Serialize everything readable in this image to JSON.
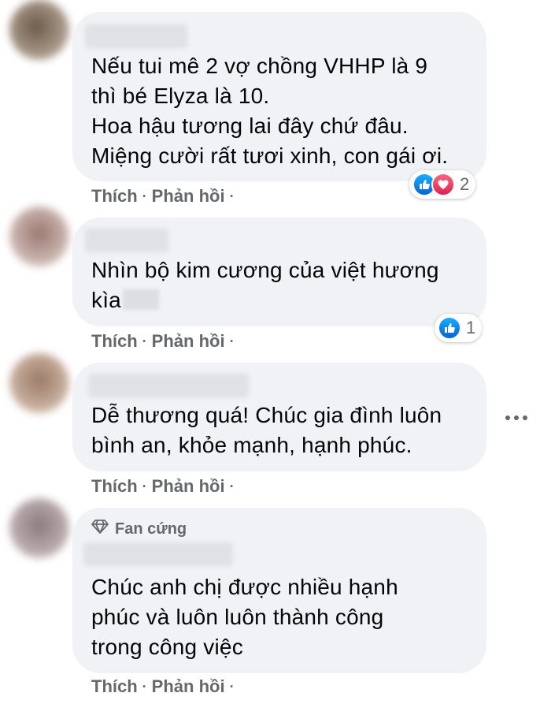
{
  "comments": [
    {
      "text": "Nếu tui mê 2 vợ chồng VHHP là 9\nthì bé Elyza là 10.\nHoa hậu tương lai đây chứ đâu.\nMiệng cười rất tươi xinh, con gái ơi.",
      "like": "Thích",
      "reply": "Phản hồi",
      "reaction_count": "2"
    },
    {
      "text": "Nhìn bộ kim cương của việt hương\nkìa",
      "like": "Thích",
      "reply": "Phản hồi",
      "reaction_count": "1"
    },
    {
      "text": "Dễ thương quá! Chúc gia đình luôn\nbình an, khỏe mạnh, hạnh phúc.",
      "like": "Thích",
      "reply": "Phản hồi"
    },
    {
      "badge": "Fan cứng",
      "text": "Chúc anh chị được nhiều hạnh\nphúc và luôn luôn thành công\ntrong công việc",
      "like": "Thích",
      "reply": "Phản hồi"
    }
  ],
  "separator": "·",
  "icons": {
    "like": "like-reaction-icon",
    "love": "love-reaction-icon",
    "badge": "diamond-icon",
    "more": "more-options-icon"
  },
  "colors": {
    "bubble": "#f0f2f5",
    "secondary_text": "#65676b",
    "like_blue": "#0a7cff",
    "love_red": "#f33e58"
  }
}
